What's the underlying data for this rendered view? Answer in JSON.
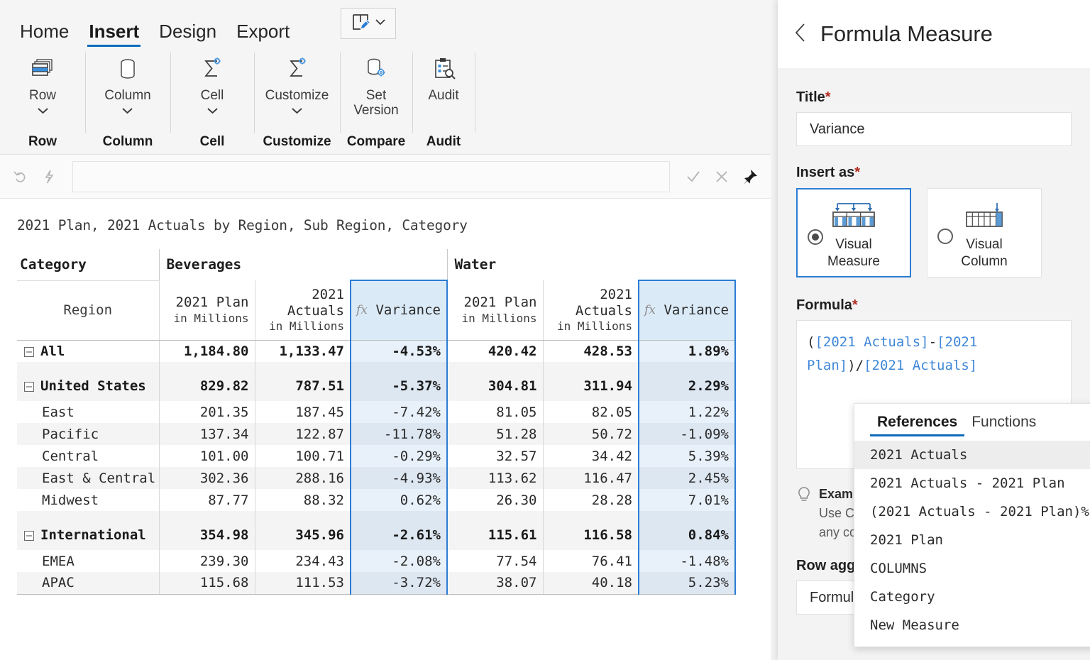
{
  "ribbon": {
    "tabs": [
      {
        "label": "Home",
        "active": false
      },
      {
        "label": "Insert",
        "active": true
      },
      {
        "label": "Design",
        "active": false
      },
      {
        "label": "Export",
        "active": false
      }
    ],
    "groups": [
      {
        "button_label": "Row",
        "has_chevron": true,
        "footer": "Row",
        "icon": "row-stack-icon"
      },
      {
        "button_label": "Column",
        "has_chevron": true,
        "footer": "Column",
        "icon": "column-cylinder-icon"
      },
      {
        "button_label": "Cell",
        "has_chevron": true,
        "footer": "Cell",
        "icon": "sigma-gear-icon"
      },
      {
        "button_label": "Customize",
        "has_chevron": true,
        "footer": "Customize",
        "icon": "sigma-gear-icon"
      },
      {
        "button_label": "Set Version",
        "has_chevron": false,
        "footer": "Compare",
        "icon": "database-gear-icon"
      },
      {
        "button_label": "Audit",
        "has_chevron": false,
        "footer": "Audit",
        "icon": "clipboard-search-icon"
      }
    ],
    "edit_mode_button": "page-edit-pencil-icon"
  },
  "formula_bar": {
    "value": "",
    "icons": [
      "undo-icon",
      "lightning-icon",
      "confirm-check-icon",
      "cancel-x-icon",
      "pin-icon"
    ]
  },
  "report": {
    "title": "2021 Plan, 2021 Actuals by Region, Sub Region, Category",
    "corner_label": "Category",
    "row_axis_label": "Region",
    "groups": [
      {
        "name": "Beverages",
        "columns": [
          {
            "title": "2021 Plan",
            "sub": "in Millions",
            "is_formula": false
          },
          {
            "title": "2021 Actuals",
            "sub": "in Millions",
            "is_formula": false
          },
          {
            "title": "Variance",
            "sub": "",
            "is_formula": true,
            "fx": "fx"
          }
        ]
      },
      {
        "name": "Water",
        "columns": [
          {
            "title": "2021 Plan",
            "sub": "in Millions",
            "is_formula": false
          },
          {
            "title": "2021 Actuals",
            "sub": "in Millions",
            "is_formula": false
          },
          {
            "title": "Variance",
            "sub": "",
            "is_formula": true,
            "fx": "fx"
          }
        ]
      }
    ],
    "rows": [
      {
        "label": "All",
        "level": 0,
        "expander": true,
        "bold": true,
        "shade": "white",
        "spacer_above": false,
        "values": [
          "1,184.80",
          "1,133.47",
          "-4.53%",
          "420.42",
          "428.53",
          "1.89%"
        ]
      },
      {
        "label": "United States",
        "level": 0,
        "expander": true,
        "bold": true,
        "shade": "grey",
        "spacer_above": true,
        "values": [
          "829.82",
          "787.51",
          "-5.37%",
          "304.81",
          "311.94",
          "2.29%"
        ]
      },
      {
        "label": "East",
        "level": 1,
        "expander": false,
        "bold": false,
        "shade": "white",
        "spacer_above": false,
        "values": [
          "201.35",
          "187.45",
          "-7.42%",
          "81.05",
          "82.05",
          "1.22%"
        ]
      },
      {
        "label": "Pacific",
        "level": 1,
        "expander": false,
        "bold": false,
        "shade": "grey",
        "spacer_above": false,
        "values": [
          "137.34",
          "122.87",
          "-11.78%",
          "51.28",
          "50.72",
          "-1.09%"
        ]
      },
      {
        "label": "Central",
        "level": 1,
        "expander": false,
        "bold": false,
        "shade": "white",
        "spacer_above": false,
        "values": [
          "101.00",
          "100.71",
          "-0.29%",
          "32.57",
          "34.42",
          "5.39%"
        ]
      },
      {
        "label": "East & Central",
        "level": 1,
        "expander": false,
        "bold": false,
        "shade": "grey",
        "spacer_above": false,
        "values": [
          "302.36",
          "288.16",
          "-4.93%",
          "113.62",
          "116.47",
          "2.45%"
        ]
      },
      {
        "label": "Midwest",
        "level": 1,
        "expander": false,
        "bold": false,
        "shade": "white",
        "spacer_above": false,
        "values": [
          "87.77",
          "88.32",
          "0.62%",
          "26.30",
          "28.28",
          "7.01%"
        ]
      },
      {
        "label": "International",
        "level": 0,
        "expander": true,
        "bold": true,
        "shade": "grey",
        "spacer_above": true,
        "values": [
          "354.98",
          "345.96",
          "-2.61%",
          "115.61",
          "116.58",
          "0.84%"
        ]
      },
      {
        "label": "EMEA",
        "level": 1,
        "expander": false,
        "bold": false,
        "shade": "white",
        "spacer_above": false,
        "values": [
          "239.30",
          "234.43",
          "-2.08%",
          "77.54",
          "76.41",
          "-1.48%"
        ]
      },
      {
        "label": "APAC",
        "level": 1,
        "expander": false,
        "bold": false,
        "shade": "grey",
        "spacer_above": false,
        "values": [
          "115.68",
          "111.53",
          "-3.72%",
          "38.07",
          "40.18",
          "5.23%"
        ]
      }
    ]
  },
  "panel": {
    "title": "Formula Measure",
    "back_icon": "chevron-left-icon",
    "title_field": {
      "label": "Title",
      "required_mark": "*",
      "value": "Variance"
    },
    "insert_as": {
      "label": "Insert as",
      "required_mark": "*",
      "options": [
        {
          "line1": "Visual",
          "line2": "Measure",
          "selected": true,
          "icon": "visual-measure-icon"
        },
        {
          "line1": "Visual",
          "line2": "Column",
          "selected": false,
          "icon": "visual-column-icon"
        }
      ]
    },
    "formula_field": {
      "label": "Formula",
      "required_mark": "*",
      "tokens": [
        {
          "text": "(",
          "type": "plain"
        },
        {
          "text": "[2021 Actuals]",
          "type": "ref"
        },
        {
          "text": "-",
          "type": "plain"
        },
        {
          "text": "[2021 Plan]",
          "type": "ref"
        },
        {
          "text": ")/",
          "type": "plain"
        },
        {
          "text": "[2021 Actuals]",
          "type": "ref"
        }
      ],
      "plain_text": "([2021 Actuals]-[2021 Plan])/[2021 Actuals]"
    },
    "hint": {
      "icon": "lightbulb-icon",
      "line1_bold": "Example",
      "line2": "Use Ctrl",
      "line3": "any co"
    },
    "row_aggregation": {
      "label": "Row agg",
      "value": "Formula"
    },
    "dropdown": {
      "tabs": [
        {
          "label": "References",
          "active": true
        },
        {
          "label": "Functions",
          "active": false
        }
      ],
      "items": [
        {
          "label": "2021 Actuals",
          "highlighted": true
        },
        {
          "label": "2021 Actuals - 2021 Plan",
          "highlighted": false
        },
        {
          "label": "(2021 Actuals - 2021 Plan)%",
          "highlighted": false
        },
        {
          "label": "2021 Plan",
          "highlighted": false
        },
        {
          "label": "COLUMNS",
          "highlighted": false
        },
        {
          "label": "Category",
          "highlighted": false
        },
        {
          "label": "New Measure",
          "highlighted": false
        }
      ]
    }
  },
  "colors": {
    "accent": "#0f6cbd",
    "formula_col_border": "#2b7cd3",
    "formula_col_bg": "#dbeaf7",
    "required": "#b02a1e",
    "panel_bg": "#f3f3f3"
  }
}
